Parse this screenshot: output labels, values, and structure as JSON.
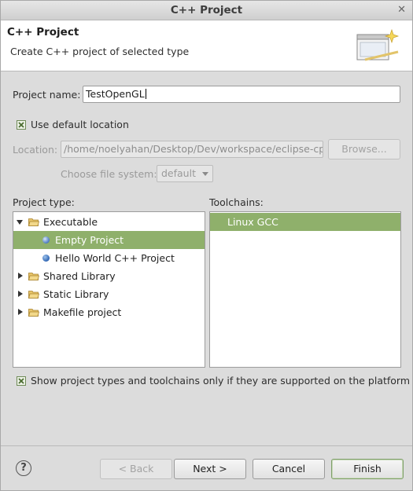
{
  "window": {
    "title": "C++ Project",
    "close_glyph": "✕"
  },
  "header": {
    "title": "C++ Project",
    "subtitle": "Create C++ project of selected type",
    "icon": "wizard-banner-icon"
  },
  "project_name": {
    "label": "Project name:",
    "value": "TestOpenGL"
  },
  "default_location": {
    "label": "Use default location",
    "checked": true
  },
  "location": {
    "label": "Location:",
    "value": "/home/noelyahan/Desktop/Dev/workspace/eclipse-cpp/",
    "browse_label": "Browse..."
  },
  "file_system": {
    "label": "Choose file system:",
    "value": "default"
  },
  "project_type": {
    "label": "Project type:",
    "items": [
      {
        "label": "Executable",
        "kind": "folder",
        "expanded": true
      },
      {
        "label": "Empty Project",
        "kind": "item",
        "selected": true
      },
      {
        "label": "Hello World C++ Project",
        "kind": "item"
      },
      {
        "label": "Shared Library",
        "kind": "folder"
      },
      {
        "label": "Static Library",
        "kind": "folder"
      },
      {
        "label": "Makefile project",
        "kind": "folder"
      }
    ]
  },
  "toolchains": {
    "label": "Toolchains:",
    "items": [
      {
        "label": "Linux GCC",
        "selected": true
      }
    ]
  },
  "show_supported": {
    "label": "Show project types and toolchains only if they are supported on the platform",
    "checked": true
  },
  "buttons": {
    "help": "?",
    "back": "< Back",
    "next": "Next >",
    "cancel": "Cancel",
    "finish": "Finish"
  },
  "colors": {
    "selection": "#8fb06b",
    "window_bg": "#dcdcdc"
  }
}
